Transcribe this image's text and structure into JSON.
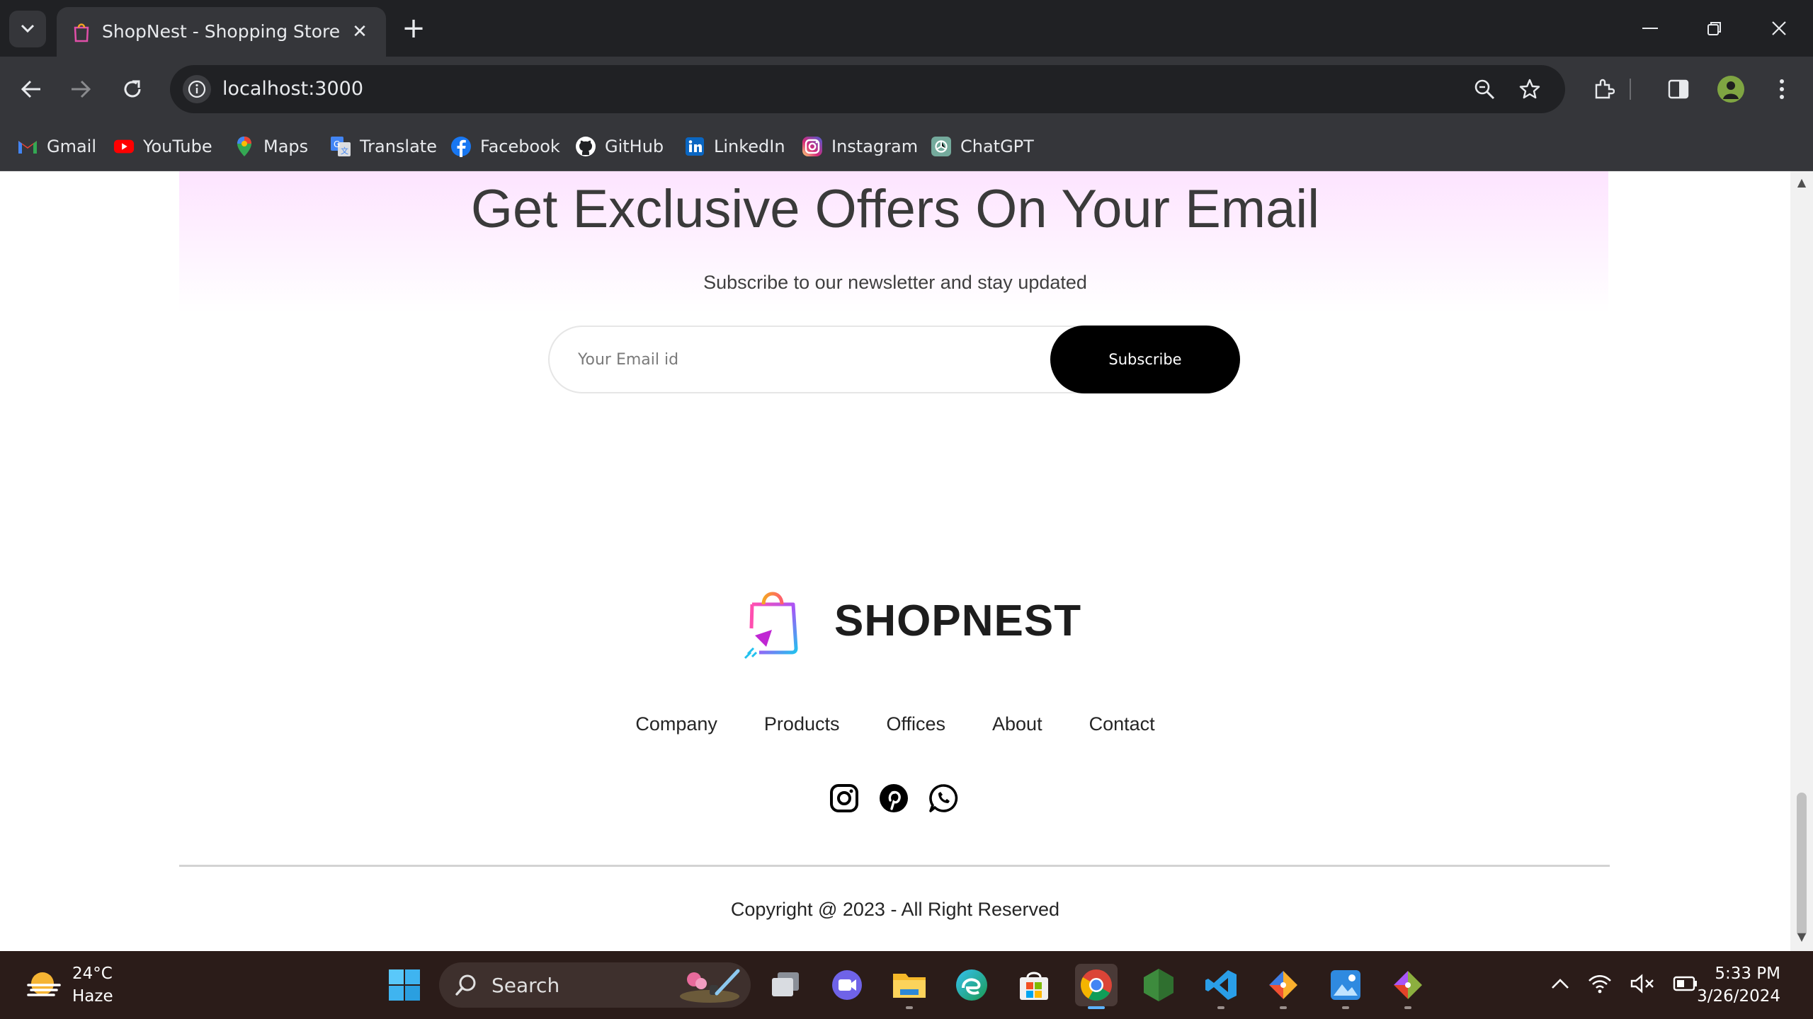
{
  "browser": {
    "tab_title": "ShopNest - Shopping Store",
    "tab_close": "✕",
    "new_tab": "+",
    "url": "localhost:3000",
    "bookmarks": [
      {
        "label": "Gmail",
        "icon": "gmail-icon",
        "color": "#ea4335"
      },
      {
        "label": "YouTube",
        "icon": "youtube-icon",
        "color": "#ff0000"
      },
      {
        "label": "Maps",
        "icon": "maps-icon",
        "color": "#34a853"
      },
      {
        "label": "Translate",
        "icon": "translate-icon",
        "color": "#4285f4"
      },
      {
        "label": "Facebook",
        "icon": "facebook-icon",
        "color": "#1877f2"
      },
      {
        "label": "GitHub",
        "icon": "github-icon",
        "color": "#ffffff"
      },
      {
        "label": "LinkedIn",
        "icon": "linkedin-icon",
        "color": "#0a66c2"
      },
      {
        "label": "Instagram",
        "icon": "instagram-icon",
        "color": "#e1306c"
      },
      {
        "label": "ChatGPT",
        "icon": "chatgpt-icon",
        "color": "#74aa9c"
      }
    ]
  },
  "newsletter": {
    "title": "Get Exclusive Offers On Your Email",
    "subtitle": "Subscribe to our newsletter and stay updated",
    "email_placeholder": "Your Email id",
    "subscribe_label": "Subscribe"
  },
  "footer": {
    "brand": "SHOPNEST",
    "links": [
      "Company",
      "Products",
      "Offices",
      "About",
      "Contact"
    ],
    "social": [
      "instagram-icon",
      "pinterest-icon",
      "whatsapp-icon"
    ],
    "copyright": "Copyright @ 2023 - All Right Reserved"
  },
  "taskbar": {
    "weather_temp": "24°C",
    "weather_desc": "Haze",
    "search_label": "Search",
    "time": "5:33 PM",
    "date": "3/26/2024",
    "apps": [
      "start-icon",
      "task-view-icon",
      "meet-icon",
      "file-explorer-icon",
      "edge-icon",
      "store-icon",
      "chrome-icon",
      "nodejs-icon",
      "vscode-icon",
      "git-icon",
      "photos-icon",
      "git-gui-icon"
    ]
  },
  "colors": {
    "accent_pink": "#fde4ff",
    "subscribe_bg": "#000000",
    "tab_bar": "#202124",
    "toolbar": "#35363a"
  }
}
